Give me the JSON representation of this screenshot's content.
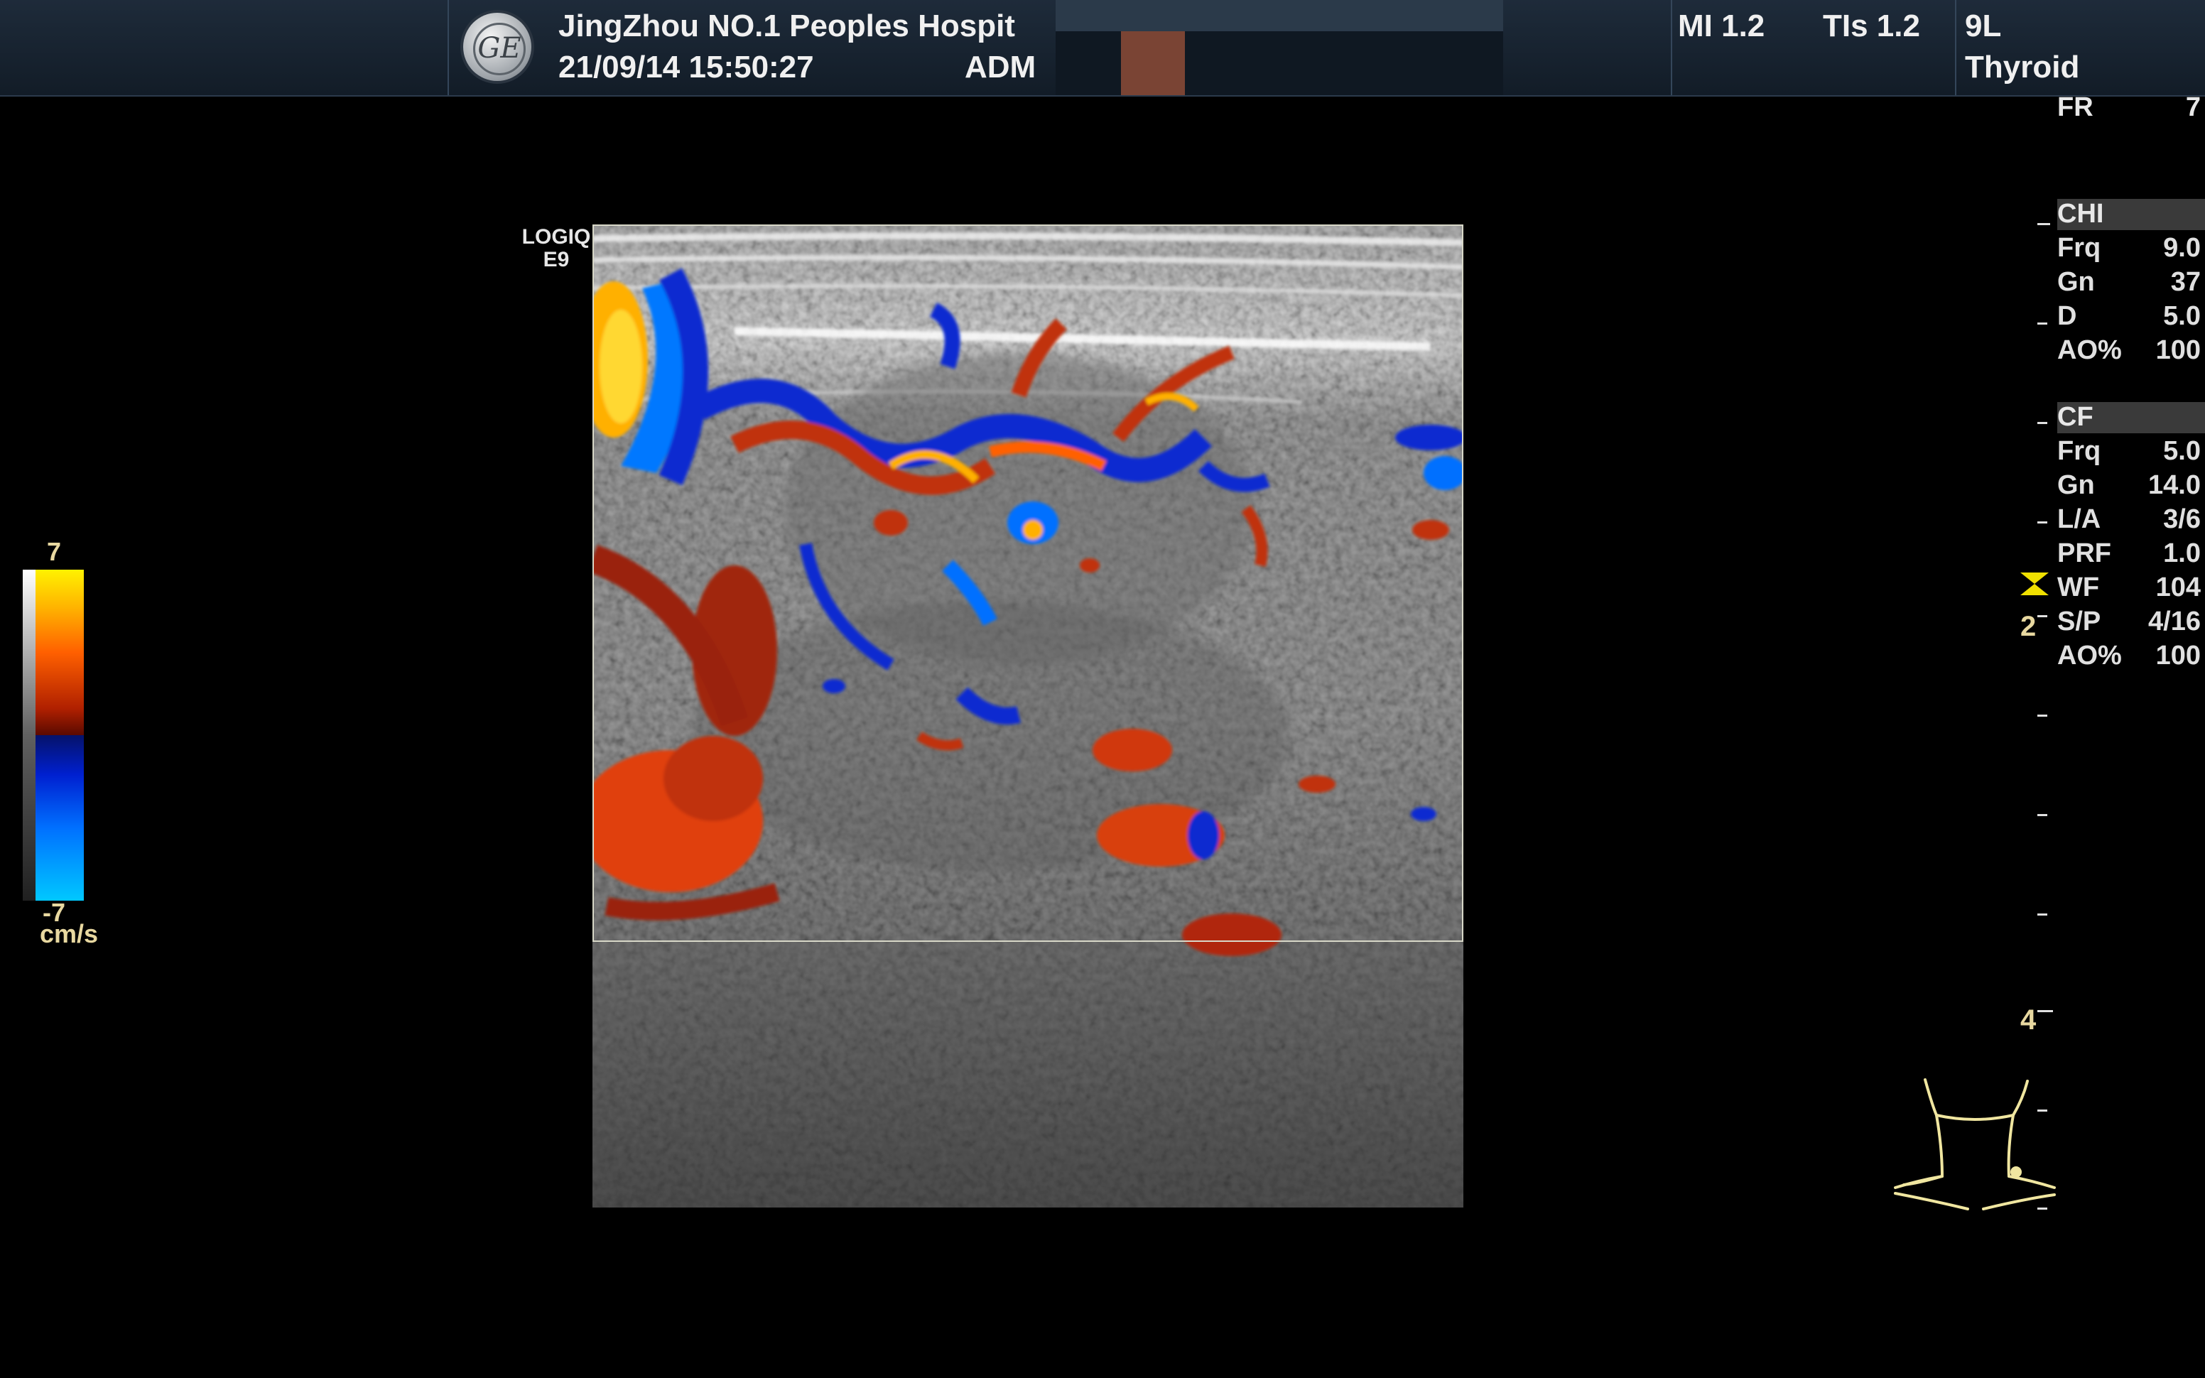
{
  "header": {
    "hospital": "JingZhou NO.1 Peoples Hospit",
    "datetime": "21/09/14 15:50:27",
    "operator": "ADM",
    "mi": "MI 1.2",
    "tis": "TIs 1.2",
    "probe": "9L",
    "preset": "Thyroid",
    "logo_text": "GE"
  },
  "frame_rate": {
    "label": "FR",
    "value": "7"
  },
  "scanner_label": {
    "line1": "LOGIQ",
    "line2": "E9"
  },
  "color_scale": {
    "max": "7",
    "min": "-7",
    "unit": "cm/s"
  },
  "chi": {
    "title": "CHI",
    "rows": [
      {
        "k": "Frq",
        "v": "9.0"
      },
      {
        "k": "Gn",
        "v": "37"
      },
      {
        "k": "D",
        "v": "5.0"
      },
      {
        "k": "AO%",
        "v": "100"
      }
    ]
  },
  "cf": {
    "title": "CF",
    "rows": [
      {
        "k": "Frq",
        "v": "5.0"
      },
      {
        "k": "Gn",
        "v": "14.0"
      },
      {
        "k": "L/A",
        "v": "3/6"
      },
      {
        "k": "PRF",
        "v": "1.0"
      },
      {
        "k": "WF",
        "v": "104"
      },
      {
        "k": "S/P",
        "v": "4/16"
      },
      {
        "k": "AO%",
        "v": "100"
      }
    ]
  },
  "depth_markers": {
    "d2": "2",
    "d4": "4"
  },
  "colors": {
    "accent_yellow": "#e8d8a0",
    "header_bg": "#1e2b3a",
    "flow_red": "#c0300a",
    "flow_blue": "#0a2ad0"
  },
  "icons": {
    "logo": "ge-logo-icon",
    "neck": "neck-bodymark-icon",
    "wf": "wall-filter-marker-icon"
  }
}
